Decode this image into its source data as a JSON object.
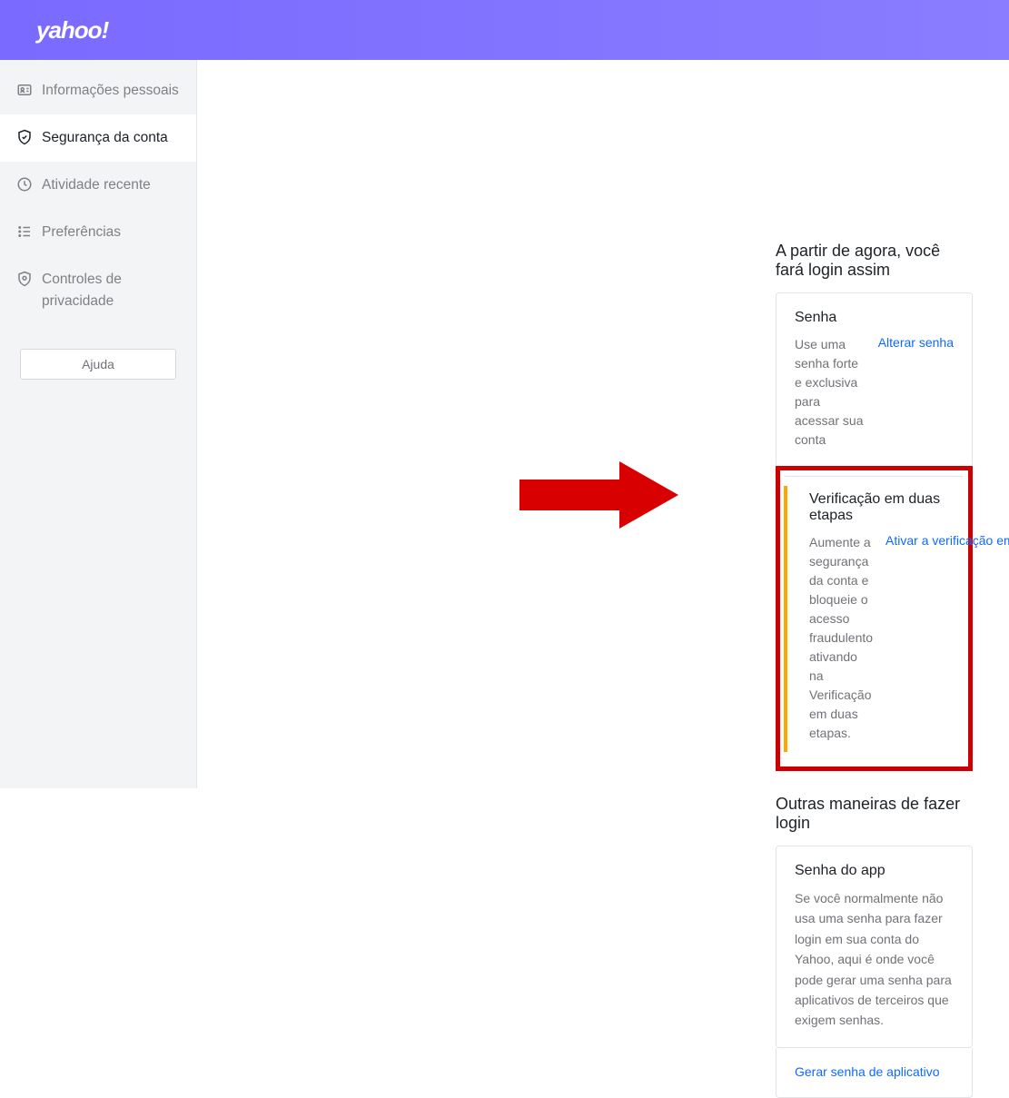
{
  "brand": "yahoo!",
  "sidebar": {
    "items": [
      {
        "label": "Informações pessoais"
      },
      {
        "label": "Segurança da conta"
      },
      {
        "label": "Atividade recente"
      },
      {
        "label": "Preferências"
      },
      {
        "label": "Controles de privacidade"
      }
    ],
    "help_label": "Ajuda"
  },
  "main": {
    "login_section_title": "A partir de agora, você fará login assim",
    "password": {
      "title": "Senha",
      "desc": "Use uma senha forte e exclusiva para acessar sua conta",
      "action": "Alterar senha"
    },
    "two_step": {
      "title": "Verificação em duas etapas",
      "desc": "Aumente a segurança da conta e bloqueie o acesso fraudulento ativando na Verificação em duas etapas.",
      "action": "Ativar a verificação em duas etapas"
    },
    "other_title": "Outras maneiras de fazer login",
    "app_password": {
      "title": "Senha do app",
      "desc": "Se você normalmente não usa uma senha para fazer login em sua conta do Yahoo, aqui é onde você pode gerar uma senha para aplicativos de terceiros que exigem senhas.",
      "action": "Gerar senha de aplicativo"
    }
  }
}
